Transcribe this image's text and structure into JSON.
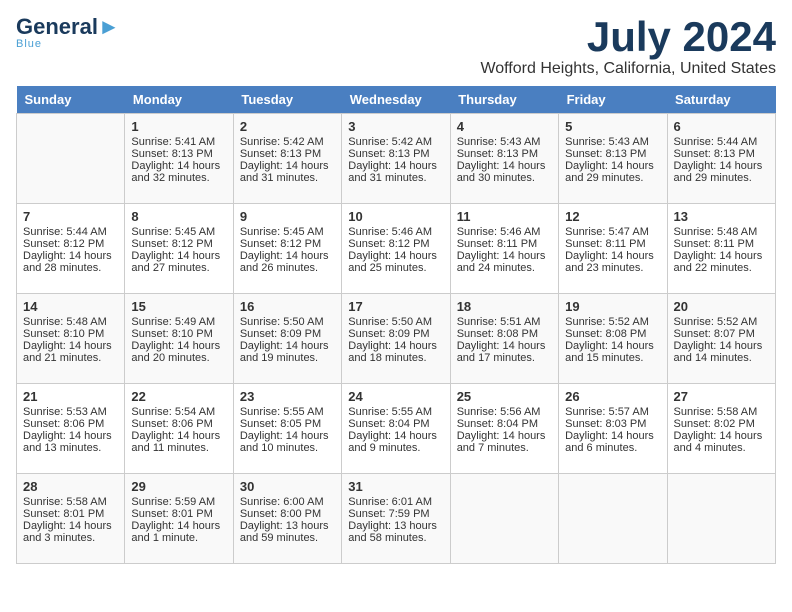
{
  "header": {
    "logo_line1": "General",
    "logo_line2": "Blue",
    "month": "July 2024",
    "location": "Wofford Heights, California, United States"
  },
  "days_of_week": [
    "Sunday",
    "Monday",
    "Tuesday",
    "Wednesday",
    "Thursday",
    "Friday",
    "Saturday"
  ],
  "weeks": [
    [
      {
        "day": "",
        "sunrise": "",
        "sunset": "",
        "daylight": ""
      },
      {
        "day": "1",
        "sunrise": "Sunrise: 5:41 AM",
        "sunset": "Sunset: 8:13 PM",
        "daylight": "Daylight: 14 hours and 32 minutes."
      },
      {
        "day": "2",
        "sunrise": "Sunrise: 5:42 AM",
        "sunset": "Sunset: 8:13 PM",
        "daylight": "Daylight: 14 hours and 31 minutes."
      },
      {
        "day": "3",
        "sunrise": "Sunrise: 5:42 AM",
        "sunset": "Sunset: 8:13 PM",
        "daylight": "Daylight: 14 hours and 31 minutes."
      },
      {
        "day": "4",
        "sunrise": "Sunrise: 5:43 AM",
        "sunset": "Sunset: 8:13 PM",
        "daylight": "Daylight: 14 hours and 30 minutes."
      },
      {
        "day": "5",
        "sunrise": "Sunrise: 5:43 AM",
        "sunset": "Sunset: 8:13 PM",
        "daylight": "Daylight: 14 hours and 29 minutes."
      },
      {
        "day": "6",
        "sunrise": "Sunrise: 5:44 AM",
        "sunset": "Sunset: 8:13 PM",
        "daylight": "Daylight: 14 hours and 29 minutes."
      }
    ],
    [
      {
        "day": "7",
        "sunrise": "Sunrise: 5:44 AM",
        "sunset": "Sunset: 8:12 PM",
        "daylight": "Daylight: 14 hours and 28 minutes."
      },
      {
        "day": "8",
        "sunrise": "Sunrise: 5:45 AM",
        "sunset": "Sunset: 8:12 PM",
        "daylight": "Daylight: 14 hours and 27 minutes."
      },
      {
        "day": "9",
        "sunrise": "Sunrise: 5:45 AM",
        "sunset": "Sunset: 8:12 PM",
        "daylight": "Daylight: 14 hours and 26 minutes."
      },
      {
        "day": "10",
        "sunrise": "Sunrise: 5:46 AM",
        "sunset": "Sunset: 8:12 PM",
        "daylight": "Daylight: 14 hours and 25 minutes."
      },
      {
        "day": "11",
        "sunrise": "Sunrise: 5:46 AM",
        "sunset": "Sunset: 8:11 PM",
        "daylight": "Daylight: 14 hours and 24 minutes."
      },
      {
        "day": "12",
        "sunrise": "Sunrise: 5:47 AM",
        "sunset": "Sunset: 8:11 PM",
        "daylight": "Daylight: 14 hours and 23 minutes."
      },
      {
        "day": "13",
        "sunrise": "Sunrise: 5:48 AM",
        "sunset": "Sunset: 8:11 PM",
        "daylight": "Daylight: 14 hours and 22 minutes."
      }
    ],
    [
      {
        "day": "14",
        "sunrise": "Sunrise: 5:48 AM",
        "sunset": "Sunset: 8:10 PM",
        "daylight": "Daylight: 14 hours and 21 minutes."
      },
      {
        "day": "15",
        "sunrise": "Sunrise: 5:49 AM",
        "sunset": "Sunset: 8:10 PM",
        "daylight": "Daylight: 14 hours and 20 minutes."
      },
      {
        "day": "16",
        "sunrise": "Sunrise: 5:50 AM",
        "sunset": "Sunset: 8:09 PM",
        "daylight": "Daylight: 14 hours and 19 minutes."
      },
      {
        "day": "17",
        "sunrise": "Sunrise: 5:50 AM",
        "sunset": "Sunset: 8:09 PM",
        "daylight": "Daylight: 14 hours and 18 minutes."
      },
      {
        "day": "18",
        "sunrise": "Sunrise: 5:51 AM",
        "sunset": "Sunset: 8:08 PM",
        "daylight": "Daylight: 14 hours and 17 minutes."
      },
      {
        "day": "19",
        "sunrise": "Sunrise: 5:52 AM",
        "sunset": "Sunset: 8:08 PM",
        "daylight": "Daylight: 14 hours and 15 minutes."
      },
      {
        "day": "20",
        "sunrise": "Sunrise: 5:52 AM",
        "sunset": "Sunset: 8:07 PM",
        "daylight": "Daylight: 14 hours and 14 minutes."
      }
    ],
    [
      {
        "day": "21",
        "sunrise": "Sunrise: 5:53 AM",
        "sunset": "Sunset: 8:06 PM",
        "daylight": "Daylight: 14 hours and 13 minutes."
      },
      {
        "day": "22",
        "sunrise": "Sunrise: 5:54 AM",
        "sunset": "Sunset: 8:06 PM",
        "daylight": "Daylight: 14 hours and 11 minutes."
      },
      {
        "day": "23",
        "sunrise": "Sunrise: 5:55 AM",
        "sunset": "Sunset: 8:05 PM",
        "daylight": "Daylight: 14 hours and 10 minutes."
      },
      {
        "day": "24",
        "sunrise": "Sunrise: 5:55 AM",
        "sunset": "Sunset: 8:04 PM",
        "daylight": "Daylight: 14 hours and 9 minutes."
      },
      {
        "day": "25",
        "sunrise": "Sunrise: 5:56 AM",
        "sunset": "Sunset: 8:04 PM",
        "daylight": "Daylight: 14 hours and 7 minutes."
      },
      {
        "day": "26",
        "sunrise": "Sunrise: 5:57 AM",
        "sunset": "Sunset: 8:03 PM",
        "daylight": "Daylight: 14 hours and 6 minutes."
      },
      {
        "day": "27",
        "sunrise": "Sunrise: 5:58 AM",
        "sunset": "Sunset: 8:02 PM",
        "daylight": "Daylight: 14 hours and 4 minutes."
      }
    ],
    [
      {
        "day": "28",
        "sunrise": "Sunrise: 5:58 AM",
        "sunset": "Sunset: 8:01 PM",
        "daylight": "Daylight: 14 hours and 3 minutes."
      },
      {
        "day": "29",
        "sunrise": "Sunrise: 5:59 AM",
        "sunset": "Sunset: 8:01 PM",
        "daylight": "Daylight: 14 hours and 1 minute."
      },
      {
        "day": "30",
        "sunrise": "Sunrise: 6:00 AM",
        "sunset": "Sunset: 8:00 PM",
        "daylight": "Daylight: 13 hours and 59 minutes."
      },
      {
        "day": "31",
        "sunrise": "Sunrise: 6:01 AM",
        "sunset": "Sunset: 7:59 PM",
        "daylight": "Daylight: 13 hours and 58 minutes."
      },
      {
        "day": "",
        "sunrise": "",
        "sunset": "",
        "daylight": ""
      },
      {
        "day": "",
        "sunrise": "",
        "sunset": "",
        "daylight": ""
      },
      {
        "day": "",
        "sunrise": "",
        "sunset": "",
        "daylight": ""
      }
    ]
  ]
}
